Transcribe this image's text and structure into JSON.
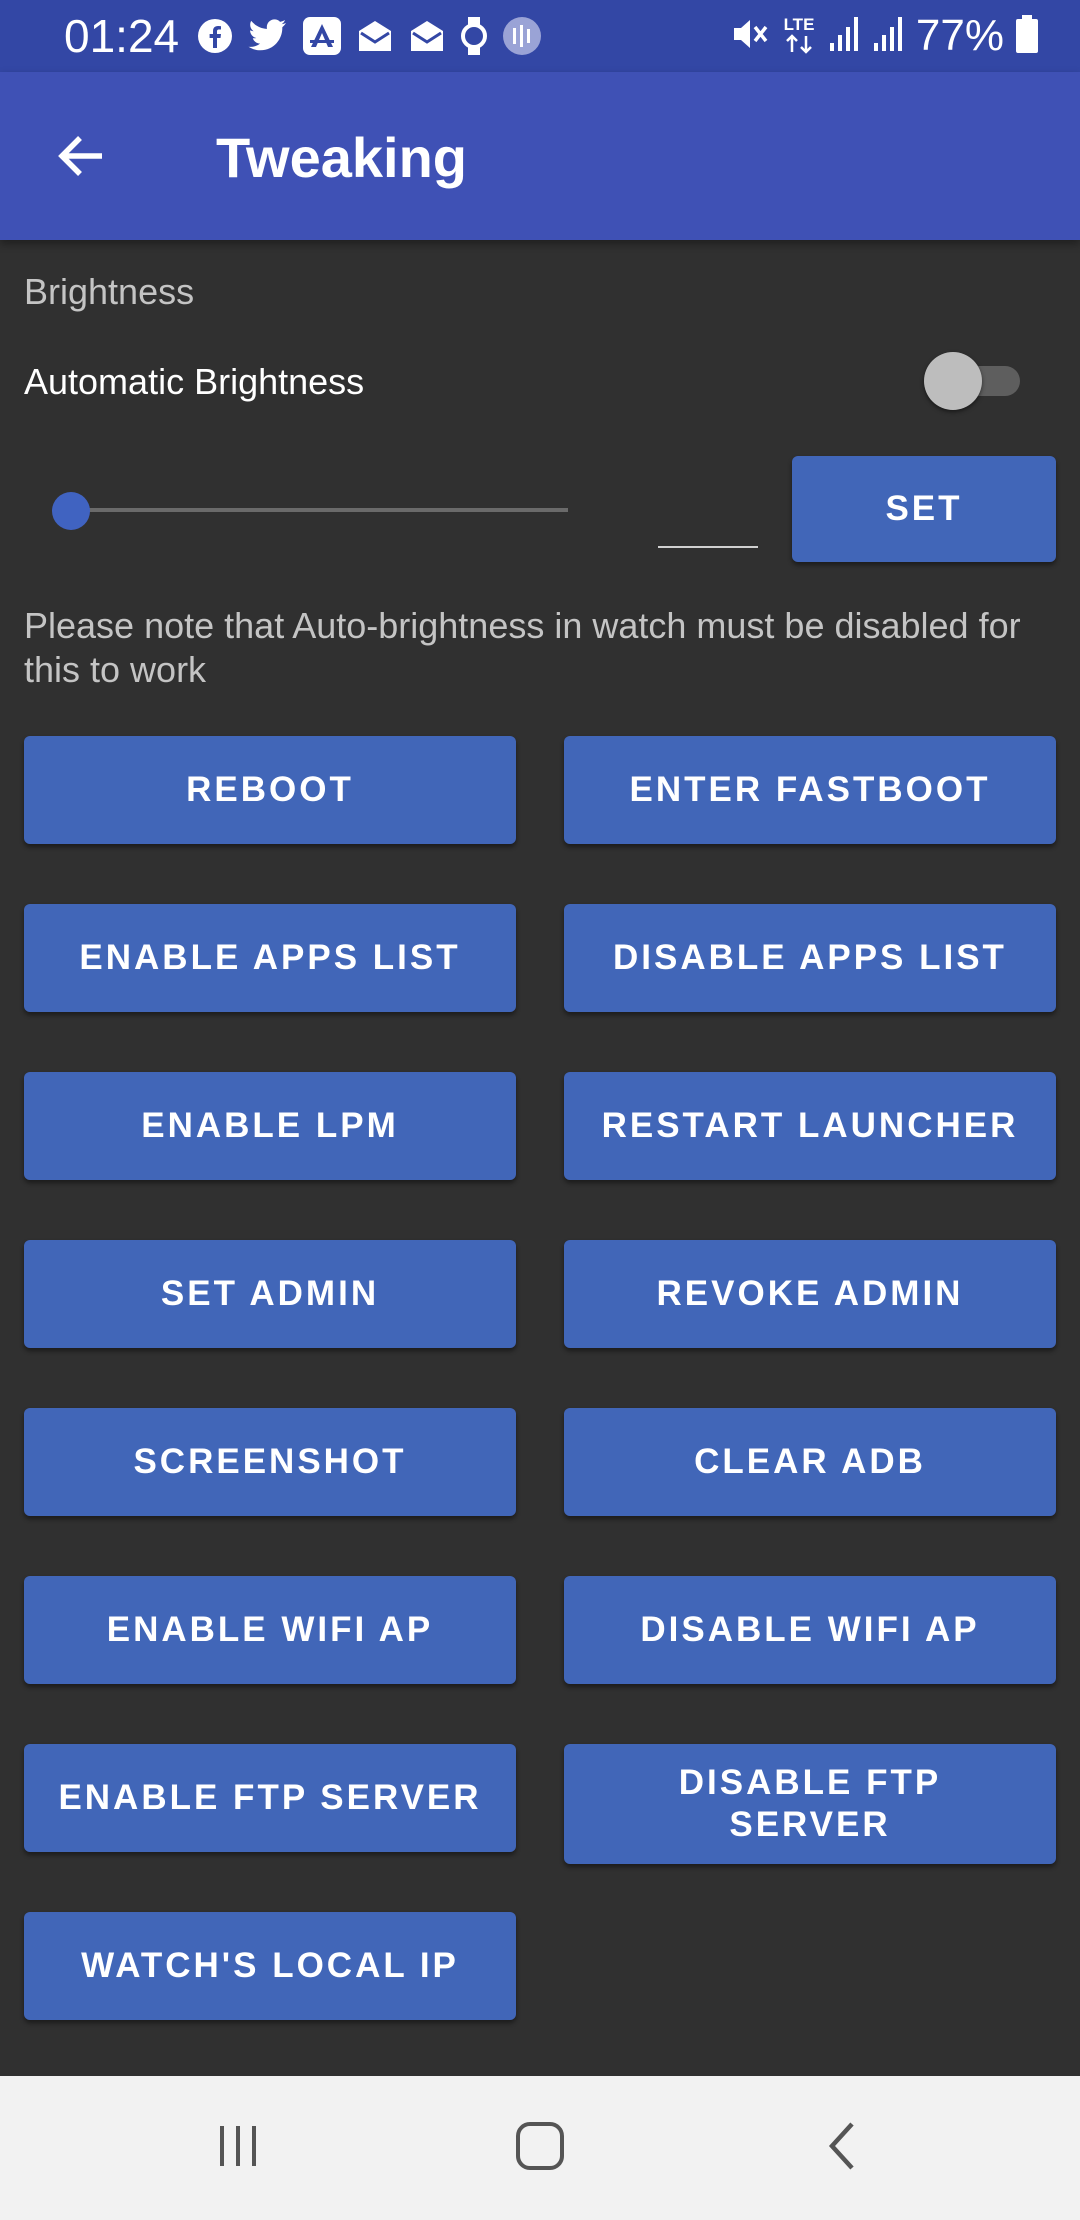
{
  "status_bar": {
    "time": "01:24",
    "battery_percent": "77%",
    "network_type": "LTE",
    "notification_icons": [
      "facebook-icon",
      "twitter-icon",
      "app-store-icon",
      "mail-icon",
      "mail-icon",
      "watch-icon",
      "equalizer-icon"
    ],
    "status_icons": [
      "mute-icon",
      "lte-icon",
      "signal-icon",
      "signal-icon",
      "battery-icon"
    ]
  },
  "app_bar": {
    "title": "Tweaking",
    "back_icon": "arrow-left-icon"
  },
  "brightness": {
    "section_header": "Brightness",
    "auto_label": "Automatic Brightness",
    "auto_enabled": false,
    "slider_level": 0,
    "input_value": "",
    "set_label": "SET",
    "note": "Please note that Auto-brightness in watch must be disabled for this to work"
  },
  "actions": [
    "REBOOT",
    "ENTER FASTBOOT",
    "ENABLE APPS LIST",
    "DISABLE APPS LIST",
    "ENABLE LPM",
    "RESTART LAUNCHER",
    "SET ADMIN",
    "REVOKE ADMIN",
    "SCREENSHOT",
    "CLEAR ADB",
    "ENABLE WIFI AP",
    "DISABLE WIFI AP",
    "ENABLE FTP SERVER",
    "DISABLE FTP SERVER",
    "WATCH'S LOCAL IP"
  ],
  "nav_bar": {
    "recents_icon": "recents-icon",
    "home_icon": "home-icon",
    "back_icon": "back-chevron-icon"
  },
  "colors": {
    "status_bar": "#3347a5",
    "app_bar": "#3f51b5",
    "background": "#303030",
    "button": "#4166b8",
    "nav_bar": "#f2f2f2"
  }
}
